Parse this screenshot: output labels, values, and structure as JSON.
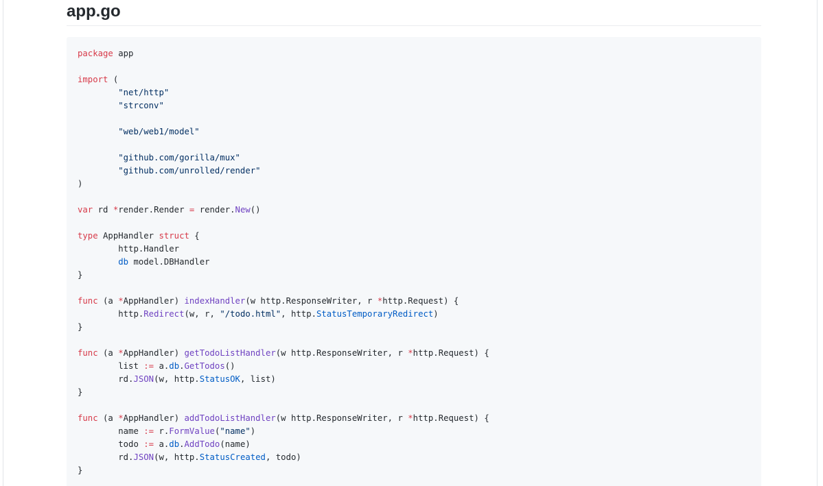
{
  "file": {
    "title": "app.go"
  },
  "theme": {
    "keyword_color": "#d73a49",
    "function_color": "#6f42c1",
    "string_color": "#032f62",
    "property_color": "#005cc5",
    "text_color": "#24292e",
    "code_background": "#f6f8fa"
  },
  "code": {
    "language": "go",
    "lines": [
      [
        {
          "t": "kw",
          "v": "package"
        },
        {
          "t": "plain",
          "v": " app"
        }
      ],
      [],
      [
        {
          "t": "kw",
          "v": "import"
        },
        {
          "t": "plain",
          "v": " ("
        }
      ],
      [
        {
          "t": "plain",
          "v": "\t"
        },
        {
          "t": "str",
          "v": "\"net/http\""
        }
      ],
      [
        {
          "t": "plain",
          "v": "\t"
        },
        {
          "t": "str",
          "v": "\"strconv\""
        }
      ],
      [],
      [
        {
          "t": "plain",
          "v": "\t"
        },
        {
          "t": "str",
          "v": "\"web/web1/model\""
        }
      ],
      [],
      [
        {
          "t": "plain",
          "v": "\t"
        },
        {
          "t": "str",
          "v": "\"github.com/gorilla/mux\""
        }
      ],
      [
        {
          "t": "plain",
          "v": "\t"
        },
        {
          "t": "str",
          "v": "\"github.com/unrolled/render\""
        }
      ],
      [
        {
          "t": "plain",
          "v": ")"
        }
      ],
      [],
      [
        {
          "t": "kw",
          "v": "var"
        },
        {
          "t": "plain",
          "v": " rd "
        },
        {
          "t": "kw",
          "v": "*"
        },
        {
          "t": "plain",
          "v": "render.Render "
        },
        {
          "t": "kw",
          "v": "="
        },
        {
          "t": "plain",
          "v": " render."
        },
        {
          "t": "fn",
          "v": "New"
        },
        {
          "t": "plain",
          "v": "()"
        }
      ],
      [],
      [
        {
          "t": "kw",
          "v": "type"
        },
        {
          "t": "plain",
          "v": " AppHandler "
        },
        {
          "t": "kw",
          "v": "struct"
        },
        {
          "t": "plain",
          "v": " {"
        }
      ],
      [
        {
          "t": "plain",
          "v": "\thttp.Handler"
        }
      ],
      [
        {
          "t": "plain",
          "v": "\t"
        },
        {
          "t": "prop",
          "v": "db"
        },
        {
          "t": "plain",
          "v": " model.DBHandler"
        }
      ],
      [
        {
          "t": "plain",
          "v": "}"
        }
      ],
      [],
      [
        {
          "t": "kw",
          "v": "func"
        },
        {
          "t": "plain",
          "v": " (a "
        },
        {
          "t": "kw",
          "v": "*"
        },
        {
          "t": "plain",
          "v": "AppHandler) "
        },
        {
          "t": "fn",
          "v": "indexHandler"
        },
        {
          "t": "plain",
          "v": "(w http.ResponseWriter, r "
        },
        {
          "t": "kw",
          "v": "*"
        },
        {
          "t": "plain",
          "v": "http.Request) {"
        }
      ],
      [
        {
          "t": "plain",
          "v": "\thttp."
        },
        {
          "t": "fn",
          "v": "Redirect"
        },
        {
          "t": "plain",
          "v": "(w, r, "
        },
        {
          "t": "str",
          "v": "\"/todo.html\""
        },
        {
          "t": "plain",
          "v": ", http."
        },
        {
          "t": "prop",
          "v": "StatusTemporaryRedirect"
        },
        {
          "t": "plain",
          "v": ")"
        }
      ],
      [
        {
          "t": "plain",
          "v": "}"
        }
      ],
      [],
      [
        {
          "t": "kw",
          "v": "func"
        },
        {
          "t": "plain",
          "v": " (a "
        },
        {
          "t": "kw",
          "v": "*"
        },
        {
          "t": "plain",
          "v": "AppHandler) "
        },
        {
          "t": "fn",
          "v": "getTodoListHandler"
        },
        {
          "t": "plain",
          "v": "(w http.ResponseWriter, r "
        },
        {
          "t": "kw",
          "v": "*"
        },
        {
          "t": "plain",
          "v": "http.Request) {"
        }
      ],
      [
        {
          "t": "plain",
          "v": "\tlist "
        },
        {
          "t": "kw",
          "v": ":="
        },
        {
          "t": "plain",
          "v": " a."
        },
        {
          "t": "prop",
          "v": "db"
        },
        {
          "t": "plain",
          "v": "."
        },
        {
          "t": "fn",
          "v": "GetTodos"
        },
        {
          "t": "plain",
          "v": "()"
        }
      ],
      [
        {
          "t": "plain",
          "v": "\trd."
        },
        {
          "t": "fn",
          "v": "JSON"
        },
        {
          "t": "plain",
          "v": "(w, http."
        },
        {
          "t": "prop",
          "v": "StatusOK"
        },
        {
          "t": "plain",
          "v": ", list)"
        }
      ],
      [
        {
          "t": "plain",
          "v": "}"
        }
      ],
      [],
      [
        {
          "t": "kw",
          "v": "func"
        },
        {
          "t": "plain",
          "v": " (a "
        },
        {
          "t": "kw",
          "v": "*"
        },
        {
          "t": "plain",
          "v": "AppHandler) "
        },
        {
          "t": "fn",
          "v": "addTodoListHandler"
        },
        {
          "t": "plain",
          "v": "(w http.ResponseWriter, r "
        },
        {
          "t": "kw",
          "v": "*"
        },
        {
          "t": "plain",
          "v": "http.Request) {"
        }
      ],
      [
        {
          "t": "plain",
          "v": "\tname "
        },
        {
          "t": "kw",
          "v": ":="
        },
        {
          "t": "plain",
          "v": " r."
        },
        {
          "t": "fn",
          "v": "FormValue"
        },
        {
          "t": "plain",
          "v": "("
        },
        {
          "t": "str",
          "v": "\"name\""
        },
        {
          "t": "plain",
          "v": ")"
        }
      ],
      [
        {
          "t": "plain",
          "v": "\ttodo "
        },
        {
          "t": "kw",
          "v": ":="
        },
        {
          "t": "plain",
          "v": " a."
        },
        {
          "t": "prop",
          "v": "db"
        },
        {
          "t": "plain",
          "v": "."
        },
        {
          "t": "fn",
          "v": "AddTodo"
        },
        {
          "t": "plain",
          "v": "(name)"
        }
      ],
      [
        {
          "t": "plain",
          "v": "\trd."
        },
        {
          "t": "fn",
          "v": "JSON"
        },
        {
          "t": "plain",
          "v": "(w, http."
        },
        {
          "t": "prop",
          "v": "StatusCreated"
        },
        {
          "t": "plain",
          "v": ", todo)"
        }
      ],
      [
        {
          "t": "plain",
          "v": "}"
        }
      ]
    ]
  }
}
